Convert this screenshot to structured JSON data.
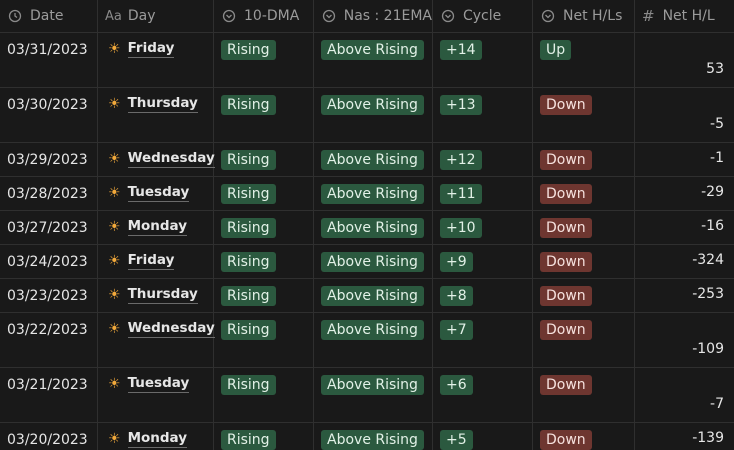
{
  "columns": {
    "date": {
      "label": "Date",
      "icon": "clock-icon"
    },
    "day": {
      "label": "Day",
      "icon_text": "Aa"
    },
    "dma": {
      "label": "10-DMA",
      "icon": "select-icon"
    },
    "nas": {
      "label": "Nas : 21EMA",
      "icon": "select-icon"
    },
    "cycle": {
      "label": "Cycle",
      "icon": "select-icon"
    },
    "net_hl": {
      "label": "Net H/Ls",
      "icon": "select-icon"
    },
    "net_num": {
      "label": "Net H/L",
      "icon_text": "#"
    }
  },
  "colors": {
    "green": "#2b593f",
    "red": "#6e3630",
    "sun": "#f2a93b"
  },
  "rows": [
    {
      "date": "03/31/2023",
      "day": "Friday",
      "dma": "Rising",
      "nas": "Above Rising",
      "cycle": "+14",
      "net_hl": "Up",
      "net_hl_color": "green",
      "net": "53",
      "tall": true
    },
    {
      "date": "03/30/2023",
      "day": "Thursday",
      "dma": "Rising",
      "nas": "Above Rising",
      "cycle": "+13",
      "net_hl": "Down",
      "net_hl_color": "red",
      "net": "-5",
      "tall": true
    },
    {
      "date": "03/29/2023",
      "day": "Wednesday",
      "dma": "Rising",
      "nas": "Above Rising",
      "cycle": "+12",
      "net_hl": "Down",
      "net_hl_color": "red",
      "net": "-1",
      "tall": false
    },
    {
      "date": "03/28/2023",
      "day": "Tuesday",
      "dma": "Rising",
      "nas": "Above Rising",
      "cycle": "+11",
      "net_hl": "Down",
      "net_hl_color": "red",
      "net": "-29",
      "tall": false
    },
    {
      "date": "03/27/2023",
      "day": "Monday",
      "dma": "Rising",
      "nas": "Above Rising",
      "cycle": "+10",
      "net_hl": "Down",
      "net_hl_color": "red",
      "net": "-16",
      "tall": false
    },
    {
      "date": "03/24/2023",
      "day": "Friday",
      "dma": "Rising",
      "nas": "Above Rising",
      "cycle": "+9",
      "net_hl": "Down",
      "net_hl_color": "red",
      "net": "-324",
      "tall": false
    },
    {
      "date": "03/23/2023",
      "day": "Thursday",
      "dma": "Rising",
      "nas": "Above Rising",
      "cycle": "+8",
      "net_hl": "Down",
      "net_hl_color": "red",
      "net": "-253",
      "tall": false
    },
    {
      "date": "03/22/2023",
      "day": "Wednesday",
      "dma": "Rising",
      "nas": "Above Rising",
      "cycle": "+7",
      "net_hl": "Down",
      "net_hl_color": "red",
      "net": "-109",
      "tall": true
    },
    {
      "date": "03/21/2023",
      "day": "Tuesday",
      "dma": "Rising",
      "nas": "Above Rising",
      "cycle": "+6",
      "net_hl": "Down",
      "net_hl_color": "red",
      "net": "-7",
      "tall": true
    },
    {
      "date": "03/20/2023",
      "day": "Monday",
      "dma": "Rising",
      "nas": "Above Rising",
      "cycle": "+5",
      "net_hl": "Down",
      "net_hl_color": "red",
      "net": "-139",
      "tall": false
    }
  ]
}
